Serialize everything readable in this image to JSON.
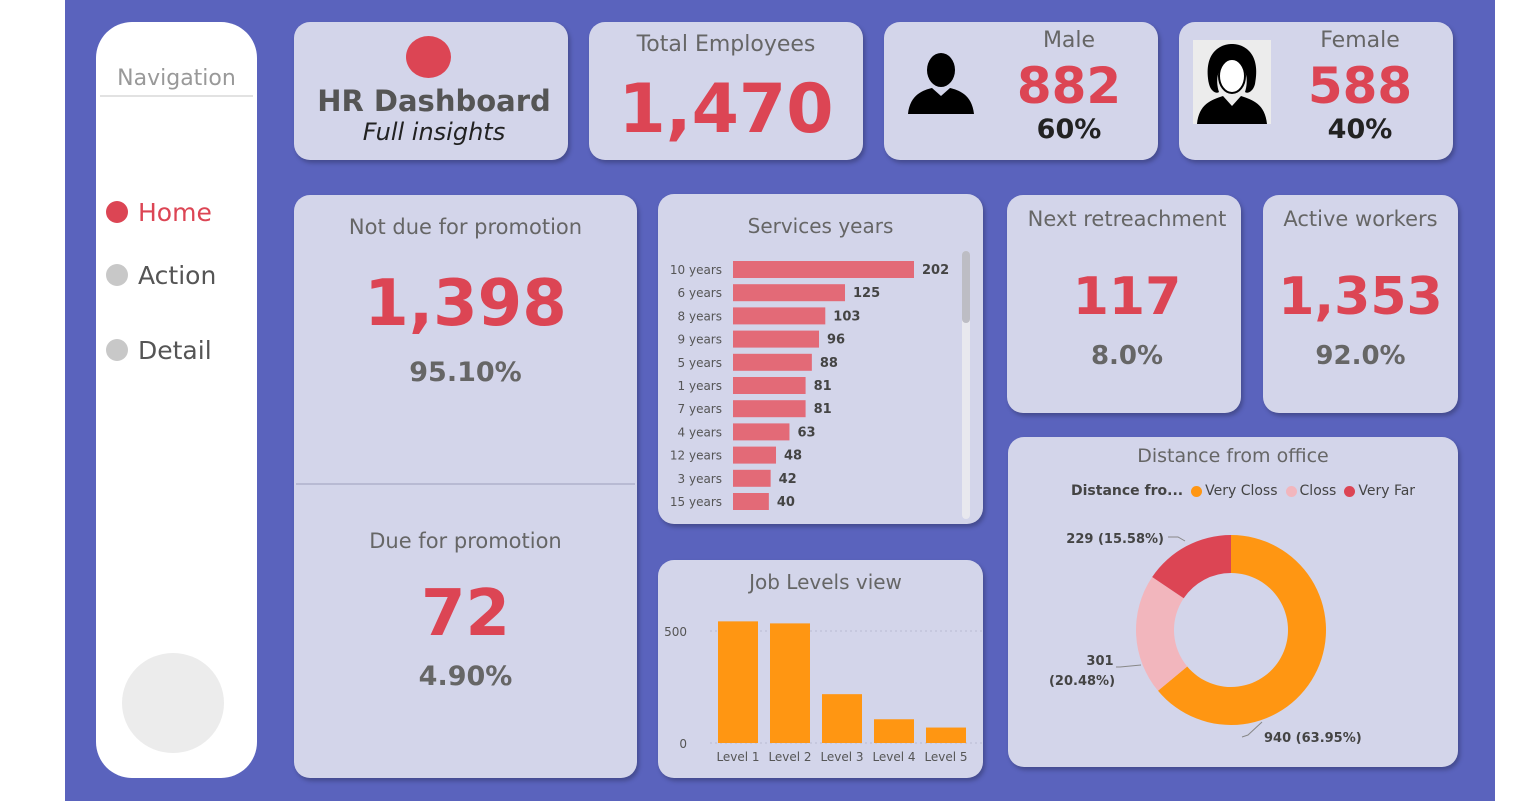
{
  "navigation": {
    "title": "Navigation",
    "items": [
      {
        "label": "Home",
        "active": true
      },
      {
        "label": "Action",
        "active": false
      },
      {
        "label": "Detail",
        "active": false
      }
    ]
  },
  "header": {
    "title": "HR Dashboard",
    "subtitle": "Full insights"
  },
  "kpis": {
    "total": {
      "label": "Total Employees",
      "value": "1,470"
    },
    "male": {
      "label": "Male",
      "value": "882",
      "pct": "60%"
    },
    "female": {
      "label": "Female",
      "value": "588",
      "pct": "40%"
    },
    "not_due": {
      "label": "Not due for promotion",
      "value": "1,398",
      "pct": "95.10%"
    },
    "due": {
      "label": "Due for promotion",
      "value": "72",
      "pct": "4.90%"
    },
    "retrenchment": {
      "label": "Next retreachment",
      "value": "117",
      "pct": "8.0%"
    },
    "active": {
      "label": "Active workers",
      "value": "1,353",
      "pct": "92.0%"
    }
  },
  "colors": {
    "accent": "#dc4554",
    "orange": "#ff9612",
    "pink": "#f2b6bd",
    "bg": "#5a63bd",
    "card": "#d3d5ea"
  },
  "chart_data": [
    {
      "type": "bar",
      "orientation": "horizontal",
      "title": "Services years",
      "categories": [
        "10 years",
        "6 years",
        "8 years",
        "9 years",
        "5 years",
        "1 years",
        "7 years",
        "4 years",
        "12 years",
        "3 years",
        "15 years"
      ],
      "values": [
        202,
        125,
        103,
        96,
        88,
        81,
        81,
        63,
        48,
        42,
        40
      ]
    },
    {
      "type": "bar",
      "title": "Job Levels view",
      "categories": [
        "Level 1",
        "Level 2",
        "Level 3",
        "Level 4",
        "Level 5"
      ],
      "values": [
        543,
        534,
        218,
        106,
        69
      ],
      "yticks": [
        "500",
        "0"
      ],
      "ylim": [
        0,
        600
      ]
    },
    {
      "type": "pie",
      "title": "Distance from office",
      "legend_title": "Distance fro...",
      "legend": [
        "Very Closs",
        "Closs",
        "Very Far"
      ],
      "values": [
        940,
        301,
        229
      ],
      "labels": [
        "940 (63.95%)",
        "301 (20.48%)",
        "229 (15.58%)"
      ],
      "colors": [
        "#ff9612",
        "#f2b6bd",
        "#dc4554"
      ]
    }
  ]
}
